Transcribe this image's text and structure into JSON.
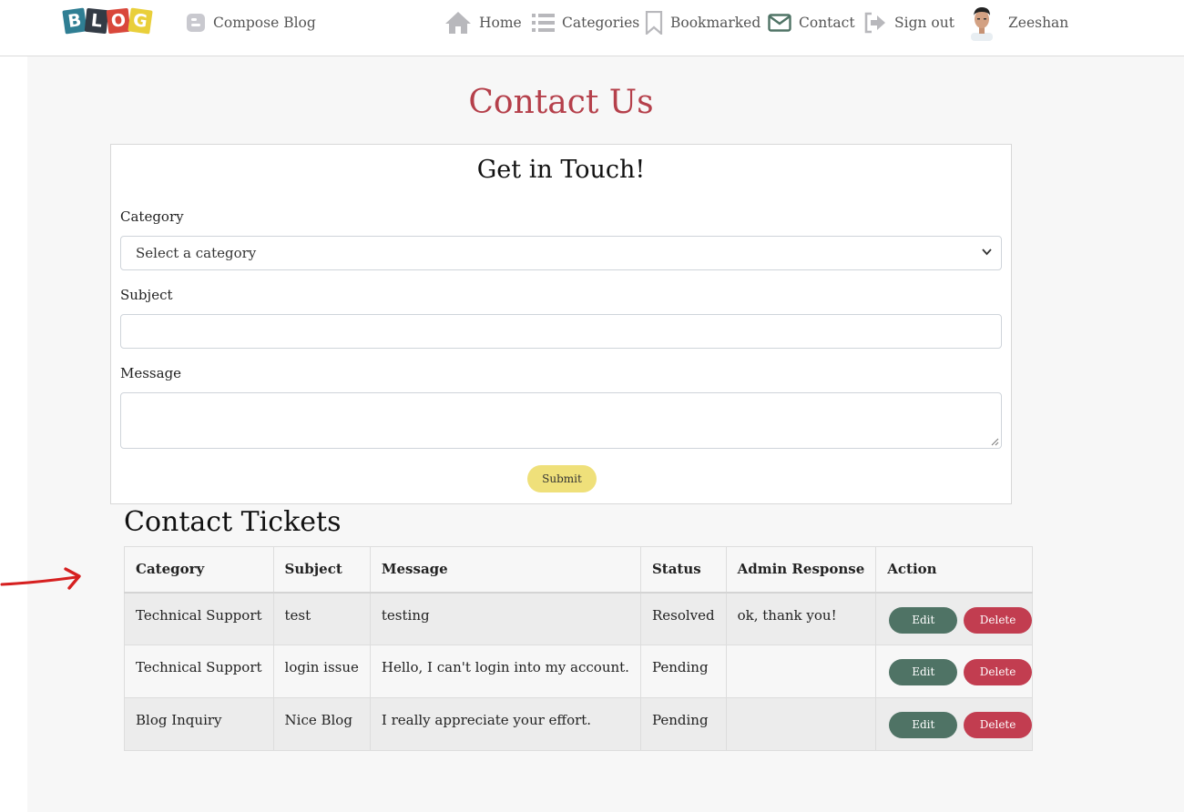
{
  "navbar": {
    "logo_letters": [
      "B",
      "L",
      "O",
      "G"
    ],
    "compose_label": "Compose Blog",
    "home_label": "Home",
    "categories_label": "Categories",
    "bookmarked_label": "Bookmarked",
    "contact_label": "Contact",
    "signout_label": "Sign out",
    "user_name": "Zeeshan"
  },
  "page": {
    "title": "Contact Us"
  },
  "form": {
    "title": "Get in Touch!",
    "category_label": "Category",
    "category_selected": "Select a category",
    "subject_label": "Subject",
    "subject_value": "",
    "message_label": "Message",
    "message_value": "",
    "submit_label": "Submit"
  },
  "tickets": {
    "title": "Contact Tickets",
    "columns": [
      "Category",
      "Subject",
      "Message",
      "Status",
      "Admin Response",
      "Action"
    ],
    "rows": [
      {
        "category": "Technical Support",
        "subject": "test",
        "message": "testing",
        "status": "Resolved",
        "response": "ok, thank you!",
        "edit": "Edit",
        "delete": "Delete"
      },
      {
        "category": "Technical Support",
        "subject": "login issue",
        "message": "Hello, I can't login into my account.",
        "status": "Pending",
        "response": "",
        "edit": "Edit",
        "delete": "Delete"
      },
      {
        "category": "Blog Inquiry",
        "subject": "Nice Blog",
        "message": "I really appreciate your effort.",
        "status": "Pending",
        "response": "",
        "edit": "Edit",
        "delete": "Delete"
      }
    ]
  },
  "colors": {
    "title_red": "#b5404b",
    "edit_green": "#4f7365",
    "delete_red": "#c23d50",
    "submit_yellow": "#efe07a",
    "annotation_arrow": "#d62020"
  },
  "icons": [
    "blogger-icon",
    "home-icon",
    "list-icon",
    "bookmark-icon",
    "envelope-icon",
    "sign-out-icon"
  ]
}
